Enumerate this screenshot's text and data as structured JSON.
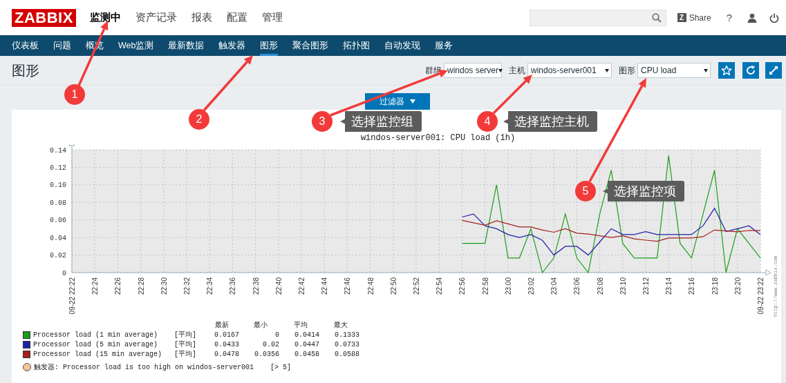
{
  "header": {
    "logo": "ZABBIX",
    "menu": [
      {
        "label": "监测中",
        "selected": true
      },
      {
        "label": "资产记录",
        "selected": false
      },
      {
        "label": "报表",
        "selected": false
      },
      {
        "label": "配置",
        "selected": false
      },
      {
        "label": "管理",
        "selected": false
      }
    ],
    "share": {
      "icon": "Z",
      "label": "Share"
    },
    "help": "?"
  },
  "nav": [
    {
      "label": "仪表板",
      "selected": false
    },
    {
      "label": "问题",
      "selected": false
    },
    {
      "label": "概览",
      "selected": false
    },
    {
      "label": "Web监测",
      "selected": false
    },
    {
      "label": "最新数据",
      "selected": false
    },
    {
      "label": "触发器",
      "selected": false
    },
    {
      "label": "图形",
      "selected": true
    },
    {
      "label": "聚合图形",
      "selected": false
    },
    {
      "label": "拓扑图",
      "selected": false
    },
    {
      "label": "自动发现",
      "selected": false
    },
    {
      "label": "服务",
      "selected": false
    }
  ],
  "page_title": "图形",
  "filters": [
    {
      "label": "群组",
      "value": "windos server"
    },
    {
      "label": "主机",
      "value": "windos-server001"
    },
    {
      "label": "图形",
      "value": "CPU load"
    }
  ],
  "filter_tab": {
    "label": "过滤器"
  },
  "graph": {
    "title": "windos-server001: CPU load (1h)",
    "chart_data": {
      "type": "line",
      "grid": true,
      "ylim": [
        0,
        0.14
      ],
      "yticks": [
        0,
        0.02,
        0.04,
        0.06,
        0.08,
        {
          "value": 0.1,
          "label": "0.10"
        },
        0.12,
        0.14
      ],
      "categories": [
        "09-22 22:22",
        null,
        "22:24",
        null,
        "22:26",
        null,
        "22:28",
        null,
        "22:30",
        null,
        "22:32",
        null,
        "22:34",
        null,
        "22:36",
        null,
        "22:38",
        null,
        "22:40",
        null,
        "22:42",
        null,
        "22:44",
        null,
        "22:46",
        null,
        "22:48",
        null,
        "22:50",
        null,
        "22:52",
        null,
        "22:54",
        null,
        "22:56",
        null,
        "22:58",
        null,
        "23:00",
        null,
        "23:02",
        null,
        "23:04",
        null,
        "23:06",
        null,
        "23:08",
        null,
        "23:10",
        null,
        "23:12",
        null,
        "23:14",
        null,
        "23:16",
        null,
        "23:18",
        null,
        "23:20",
        null,
        "09-22 23:22"
      ],
      "series": [
        {
          "name": "Processor load (1 min average)",
          "color": "#1a9e1a",
          "values": [
            null,
            null,
            null,
            null,
            null,
            null,
            null,
            null,
            null,
            null,
            null,
            null,
            null,
            null,
            null,
            null,
            null,
            null,
            null,
            null,
            null,
            null,
            null,
            null,
            null,
            null,
            null,
            null,
            null,
            null,
            null,
            null,
            null,
            null,
            0.0333,
            0.0333,
            0.0333,
            0.1,
            0.0167,
            0.0167,
            0.05,
            0,
            0.0167,
            0.0667,
            0.0167,
            0,
            0.0667,
            0.1167,
            0.0333,
            0.0167,
            0.0167,
            0.0167,
            0.1333,
            0.0333,
            0.0167,
            0.0667,
            0.1167,
            0,
            0.05,
            0.0333,
            0.0167
          ]
        },
        {
          "name": "Processor load (5 min average)",
          "color": "#2020a8",
          "values": [
            null,
            null,
            null,
            null,
            null,
            null,
            null,
            null,
            null,
            null,
            null,
            null,
            null,
            null,
            null,
            null,
            null,
            null,
            null,
            null,
            null,
            null,
            null,
            null,
            null,
            null,
            null,
            null,
            null,
            null,
            null,
            null,
            null,
            null,
            0.0633,
            0.0667,
            0.0533,
            0.05,
            0.0433,
            0.04,
            0.0433,
            0.0367,
            0.02,
            0.03,
            0.03,
            0.02,
            0.035,
            0.05,
            0.0433,
            0.0433,
            0.0467,
            0.0433,
            0.0433,
            0.0433,
            0.0433,
            0.0533,
            0.0733,
            0.0467,
            0.05,
            0.0533,
            0.0433
          ]
        },
        {
          "name": "Processor load (15 min average)",
          "color": "#a81e1e",
          "values": [
            null,
            null,
            null,
            null,
            null,
            null,
            null,
            null,
            null,
            null,
            null,
            null,
            null,
            null,
            null,
            null,
            null,
            null,
            null,
            null,
            null,
            null,
            null,
            null,
            null,
            null,
            null,
            null,
            null,
            null,
            null,
            null,
            null,
            null,
            0.0595,
            0.0567,
            0.054,
            0.059,
            0.0555,
            0.052,
            0.052,
            0.0485,
            0.046,
            0.05,
            0.045,
            0.044,
            0.042,
            0.04,
            0.042,
            0.0385,
            0.037,
            0.0356,
            0.0395,
            0.0395,
            0.0395,
            0.041,
            0.0485,
            0.0475,
            0.0465,
            0.048,
            0.0478
          ]
        }
      ]
    },
    "legend": {
      "columns": [
        "最新",
        "最小",
        "平均",
        "最大"
      ],
      "rows": [
        {
          "function": "[平均]",
          "values": [
            "0.0167",
            "0",
            "0.0414",
            "0.1333"
          ]
        },
        {
          "function": "[平均]",
          "values": [
            "0.0433",
            "0.02",
            "0.0447",
            "0.0733"
          ]
        },
        {
          "function": "[平均]",
          "values": [
            "0.0478",
            "0.0356",
            "0.0458",
            "0.0588"
          ]
        }
      ]
    },
    "trigger": {
      "color": "#f6c59c",
      "text": "触发器: Processor load is too high on windos-server001",
      "threshold": "[> 5]"
    },
    "credit": "http://www.zabbix.com"
  },
  "annotations": [
    {
      "number": "1"
    },
    {
      "number": "2"
    },
    {
      "number": "3",
      "note": "选择监控组"
    },
    {
      "number": "4",
      "note": "选择监控主机"
    },
    {
      "number": "5",
      "note": "选择监控项"
    }
  ]
}
